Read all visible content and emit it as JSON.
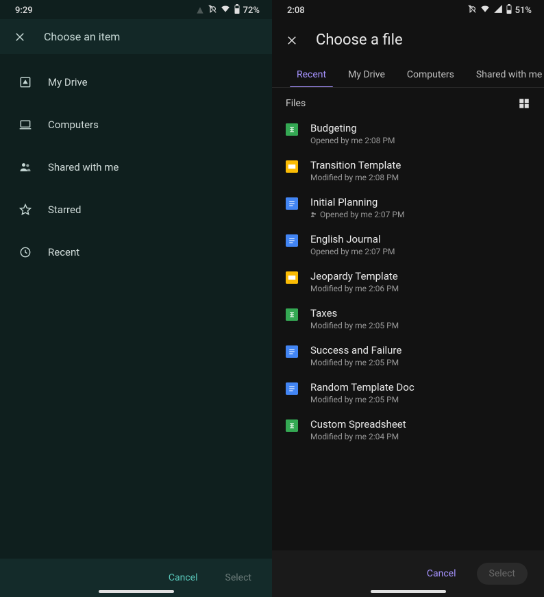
{
  "left": {
    "time": "9:29",
    "battery": "72%",
    "title": "Choose an item",
    "sources": [
      {
        "icon": "drive",
        "label": "My Drive"
      },
      {
        "icon": "laptop",
        "label": "Computers"
      },
      {
        "icon": "people",
        "label": "Shared with me"
      },
      {
        "icon": "star",
        "label": "Starred"
      },
      {
        "icon": "clock",
        "label": "Recent"
      }
    ],
    "cancel": "Cancel",
    "select": "Select"
  },
  "right": {
    "time": "2:08",
    "battery": "51%",
    "title": "Choose a file",
    "tabs": [
      {
        "label": "Recent",
        "active": true
      },
      {
        "label": "My Drive",
        "active": false
      },
      {
        "label": "Computers",
        "active": false
      },
      {
        "label": "Shared with me",
        "active": false
      }
    ],
    "files_heading": "Files",
    "files": [
      {
        "icon": "sheet",
        "name": "Budgeting",
        "meta": "Opened by me 2:08 PM",
        "shared": false
      },
      {
        "icon": "slide",
        "name": "Transition Template",
        "meta": "Modified by me 2:08 PM",
        "shared": false
      },
      {
        "icon": "doc",
        "name": "Initial Planning",
        "meta": "Opened by me 2:07 PM",
        "shared": true
      },
      {
        "icon": "doc",
        "name": "English Journal",
        "meta": "Opened by me 2:07 PM",
        "shared": false
      },
      {
        "icon": "slide",
        "name": "Jeopardy Template",
        "meta": "Modified by me 2:06 PM",
        "shared": false
      },
      {
        "icon": "sheet",
        "name": "Taxes",
        "meta": "Modified by me 2:05 PM",
        "shared": false
      },
      {
        "icon": "doc",
        "name": "Success and Failure",
        "meta": "Modified by me 2:05 PM",
        "shared": false
      },
      {
        "icon": "doc",
        "name": "Random Template Doc",
        "meta": "Modified by me 2:05 PM",
        "shared": false
      },
      {
        "icon": "sheet",
        "name": "Custom Spreadsheet",
        "meta": "Modified by me 2:04 PM",
        "shared": false
      }
    ],
    "cancel": "Cancel",
    "select": "Select"
  }
}
